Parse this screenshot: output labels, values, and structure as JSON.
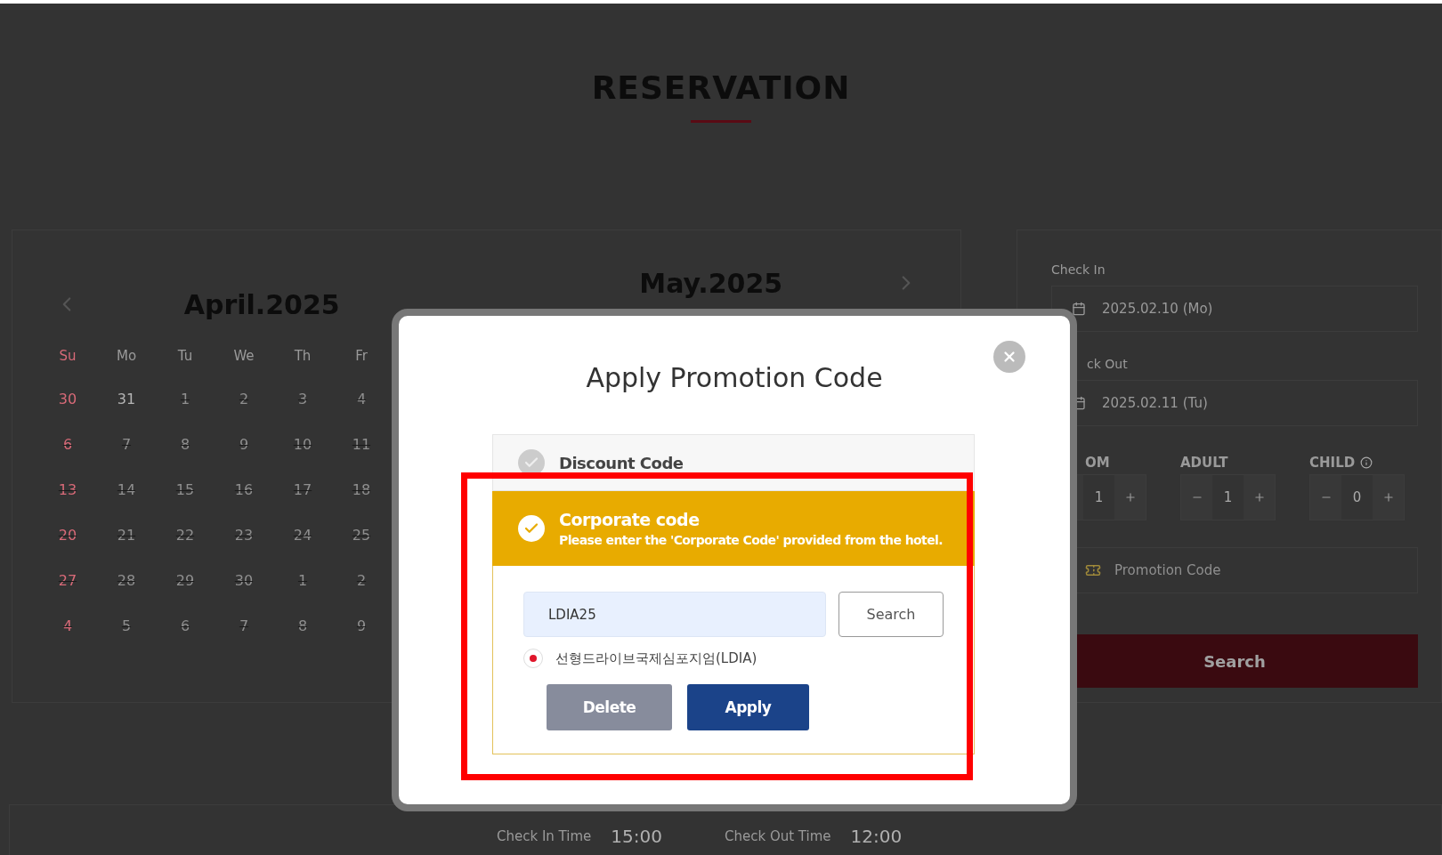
{
  "page": {
    "title": "RESERVATION"
  },
  "calendar": {
    "months": [
      {
        "title": "April.2025",
        "weekdays": [
          "Su",
          "Mo",
          "Tu",
          "We",
          "Th",
          "Fr"
        ],
        "weeks": [
          [
            {
              "day": "30",
              "struck": false
            },
            {
              "day": "31",
              "struck": false
            },
            {
              "day": "1",
              "struck": true
            },
            {
              "day": "2",
              "struck": true
            },
            {
              "day": "3",
              "struck": true
            },
            {
              "day": "4",
              "struck": true
            }
          ],
          [
            {
              "day": "6",
              "struck": true
            },
            {
              "day": "7",
              "struck": true
            },
            {
              "day": "8",
              "struck": true
            },
            {
              "day": "9",
              "struck": true
            },
            {
              "day": "10",
              "struck": true
            },
            {
              "day": "11",
              "struck": true
            }
          ],
          [
            {
              "day": "13",
              "struck": true
            },
            {
              "day": "14",
              "struck": true
            },
            {
              "day": "15",
              "struck": true
            },
            {
              "day": "16",
              "struck": true
            },
            {
              "day": "17",
              "struck": true
            },
            {
              "day": "18",
              "struck": true
            }
          ],
          [
            {
              "day": "20",
              "struck": true
            },
            {
              "day": "21",
              "struck": true
            },
            {
              "day": "22",
              "struck": true
            },
            {
              "day": "23",
              "struck": true
            },
            {
              "day": "24",
              "struck": true
            },
            {
              "day": "25",
              "struck": true
            }
          ],
          [
            {
              "day": "27",
              "struck": true
            },
            {
              "day": "28",
              "struck": true
            },
            {
              "day": "29",
              "struck": true
            },
            {
              "day": "30",
              "struck": true
            },
            {
              "day": "1",
              "struck": true
            },
            {
              "day": "2",
              "struck": true
            }
          ],
          [
            {
              "day": "4",
              "struck": true
            },
            {
              "day": "5",
              "struck": true
            },
            {
              "day": "6",
              "struck": true
            },
            {
              "day": "7",
              "struck": true
            },
            {
              "day": "8",
              "struck": true
            },
            {
              "day": "9",
              "struck": true
            }
          ]
        ]
      },
      {
        "title": "May.2025"
      }
    ]
  },
  "booking": {
    "check_in": {
      "label": "Check In",
      "value": "2025.02.10 (Mo)"
    },
    "check_out": {
      "label": "ck Out",
      "value": "2025.02.11 (Tu)"
    },
    "guests": [
      {
        "label": "OM",
        "value": "1",
        "info": false
      },
      {
        "label": "ADULT",
        "value": "1",
        "info": false
      },
      {
        "label": "CHILD",
        "value": "0",
        "info": true
      }
    ],
    "promotion": {
      "placeholder": "Promotion Code"
    },
    "search_button": "Search"
  },
  "footer": [
    {
      "label": "Check In Time",
      "value": "15:00"
    },
    {
      "label": "Check Out Time",
      "value": "12:00"
    }
  ],
  "modal": {
    "title": "Apply Promotion Code",
    "options": [
      {
        "label": "Discount Code",
        "selected": false
      },
      {
        "label": "Corporate code",
        "hint": "Please enter the 'Corporate Code' provided from the hotel.",
        "selected": true
      }
    ],
    "code_value": "LDIA25",
    "search_button": "Search",
    "results": [
      {
        "label": "선형드라이브국제심포지엄(LDIA)",
        "selected": true
      }
    ],
    "buttons": [
      {
        "label": "Delete",
        "kind": "delete"
      },
      {
        "label": "Apply",
        "kind": "apply"
      }
    ]
  }
}
